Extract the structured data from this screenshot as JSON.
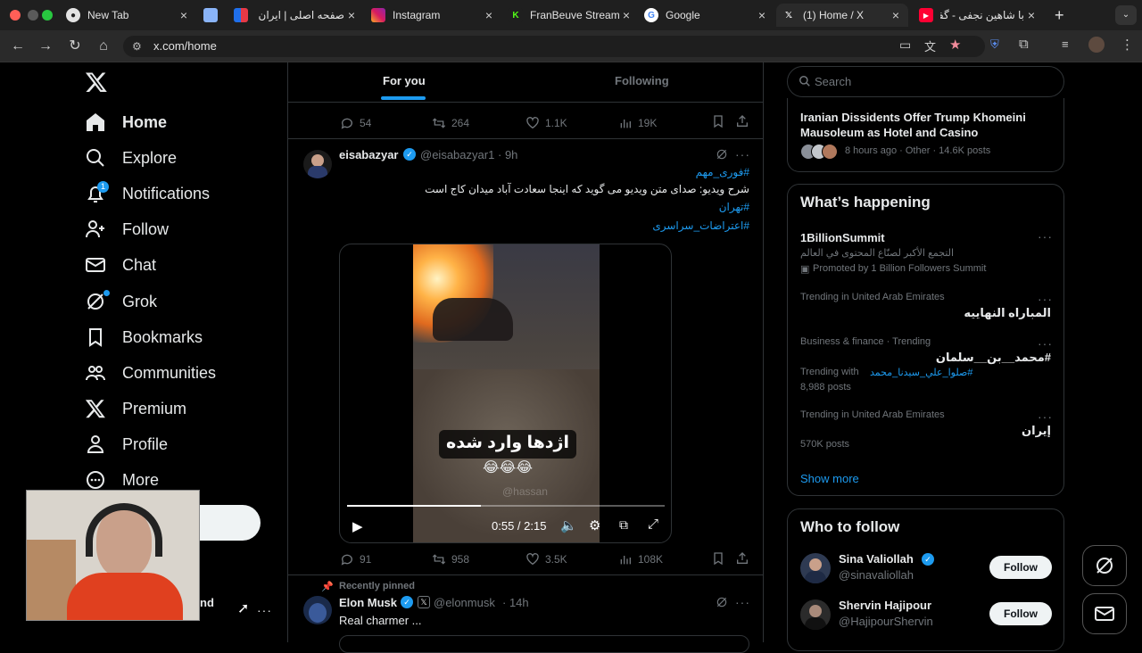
{
  "browser": {
    "tabs": [
      {
        "title": "New Tab"
      },
      {
        "title": ""
      },
      {
        "title": "صفحه اصلی | ایران"
      },
      {
        "title": "Instagram"
      },
      {
        "title": "FranBeuve Stream"
      },
      {
        "title": "Google"
      },
      {
        "title": "(1) Home / X"
      },
      {
        "title": "با شاهین نجفی - گفتگو"
      }
    ],
    "url": "x.com/home"
  },
  "sidebar": {
    "items": [
      {
        "label": "Home",
        "icon": "home-icon"
      },
      {
        "label": "Explore",
        "icon": "search-icon"
      },
      {
        "label": "Notifications",
        "icon": "bell-icon",
        "badge": "1"
      },
      {
        "label": "Follow",
        "icon": "person-add-icon"
      },
      {
        "label": "Chat",
        "icon": "mail-icon"
      },
      {
        "label": "Grok",
        "icon": "grok-icon"
      },
      {
        "label": "Bookmarks",
        "icon": "bookmark-icon"
      },
      {
        "label": "Communities",
        "icon": "people-icon"
      },
      {
        "label": "Premium",
        "icon": "x-logo-icon"
      },
      {
        "label": "Profile",
        "icon": "person-icon"
      },
      {
        "label": "More",
        "icon": "more-circle-icon"
      }
    ],
    "account_fragment": "nd",
    "account_menu": "···"
  },
  "feed": {
    "tabs": [
      {
        "label": "For you"
      },
      {
        "label": "Following"
      }
    ],
    "top_actions": {
      "replies": "54",
      "reposts": "264",
      "likes": "1.1K",
      "views": "19K"
    },
    "post1": {
      "name": "eisabazyar",
      "handle": "@eisabazyar1",
      "time": "· 9h",
      "lines": [
        "#فوری_مهم",
        "شرح ویدیو: صدای متن ویدیو می گوید که اینجا سعادت آباد میدان کاج است",
        "#تهران",
        "#اعتراضات_سراسری"
      ],
      "video_caption": "اژدها وارد شده",
      "video_emoji": "😂😂😂",
      "video_time": "0:55 / 2:15",
      "watermark": "@hassan",
      "progress": 0.42,
      "actions": {
        "replies": "91",
        "reposts": "958",
        "likes": "3.5K",
        "views": "108K"
      }
    },
    "post2": {
      "pinned": "Recently pinned",
      "name": "Elon Musk",
      "handle": "@elonmusk",
      "time": "· 14h",
      "text": "Real charmer ..."
    }
  },
  "right": {
    "search_placeholder": "Search",
    "top_news": {
      "title": "Iranian Dissidents Offer Trump Khomeini Mausoleum as Hotel and Casino",
      "meta": "8 hours ago · Other · 14.6K posts"
    },
    "whats_happening": {
      "title": "What’s happening",
      "items": [
        {
          "name": "1BillionSummit",
          "sub": "التجمع الأكبر لصنّاع المحتوى في العالم",
          "promo": "Promoted by 1 Billion Followers Summit"
        },
        {
          "context": "Trending in United Arab Emirates",
          "name": "المباراه النهاييه"
        },
        {
          "context": "Business & finance · Trending",
          "name": "#محمد__بن__سلمان",
          "with_label": "Trending with",
          "with_tag": "#صلوا_علي_سيدنا_محمد",
          "posts": "8,988 posts"
        },
        {
          "context": "Trending in United Arab Emirates",
          "name": "إيران",
          "posts": "570K posts"
        }
      ],
      "show_more": "Show more"
    },
    "who_to_follow": {
      "title": "Who to follow",
      "people": [
        {
          "name": "Sina Valiollah",
          "handle": "@sinavaliollah",
          "button": "Follow"
        },
        {
          "name": "Shervin Hajipour",
          "handle": "@HajipourShervin",
          "button": "Follow"
        }
      ]
    }
  },
  "colors": {
    "accent": "#1d9bf0",
    "border": "#2f3336",
    "muted": "#71767b"
  }
}
